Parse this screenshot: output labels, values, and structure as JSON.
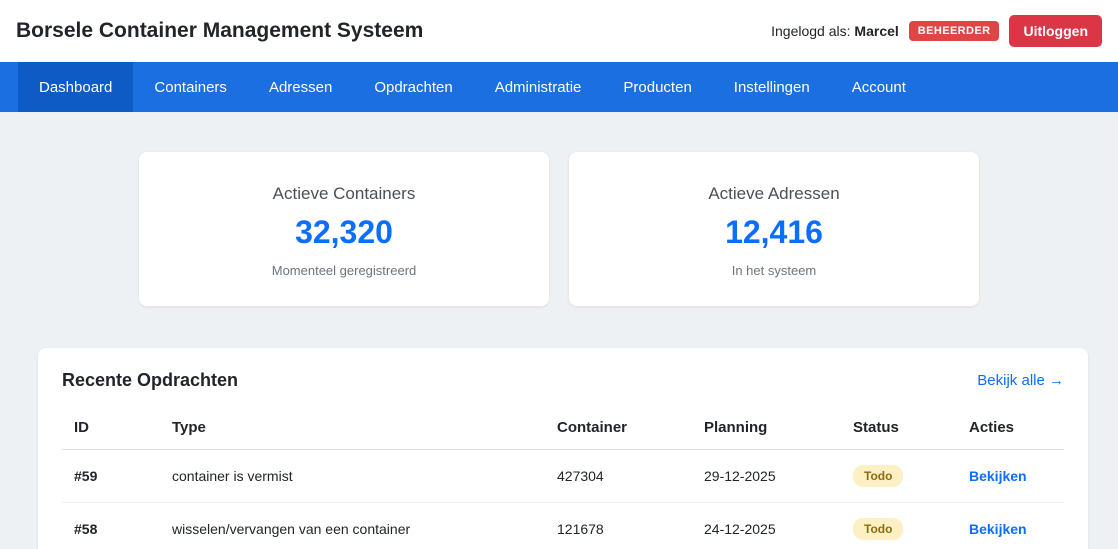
{
  "header": {
    "title": "Borsele Container Management Systeem",
    "logged_in_label": "Ingelogd als:",
    "username": "Marcel",
    "role_badge": "BEHEERDER",
    "logout_label": "Uitloggen"
  },
  "nav": {
    "items": [
      {
        "label": "Dashboard",
        "active": true
      },
      {
        "label": "Containers",
        "active": false
      },
      {
        "label": "Adressen",
        "active": false
      },
      {
        "label": "Opdrachten",
        "active": false
      },
      {
        "label": "Administratie",
        "active": false
      },
      {
        "label": "Producten",
        "active": false
      },
      {
        "label": "Instellingen",
        "active": false
      },
      {
        "label": "Account",
        "active": false
      }
    ]
  },
  "stats": [
    {
      "title": "Actieve Containers",
      "value": "32,320",
      "subtitle": "Momenteel geregistreerd"
    },
    {
      "title": "Actieve Adressen",
      "value": "12,416",
      "subtitle": "In het systeem"
    }
  ],
  "recent": {
    "title": "Recente Opdrachten",
    "view_all": "Bekijk alle →",
    "columns": [
      "ID",
      "Type",
      "Container",
      "Planning",
      "Status",
      "Acties"
    ],
    "rows": [
      {
        "id": "#59",
        "type": "container is vermist",
        "container": "427304",
        "planning": "29-12-2025",
        "status": "Todo",
        "action": "Bekijken"
      },
      {
        "id": "#58",
        "type": "wisselen/vervangen van een container",
        "container": "121678",
        "planning": "24-12-2025",
        "status": "Todo",
        "action": "Bekijken"
      }
    ]
  },
  "colors": {
    "nav_blue": "#1b6fe0",
    "nav_active_blue": "#0f5bc5",
    "accent_blue": "#0d6efd",
    "danger_red": "#dc3545",
    "badge_red": "#e04545",
    "status_todo_bg": "#fdf0c4",
    "status_todo_text": "#8a6d0b"
  }
}
